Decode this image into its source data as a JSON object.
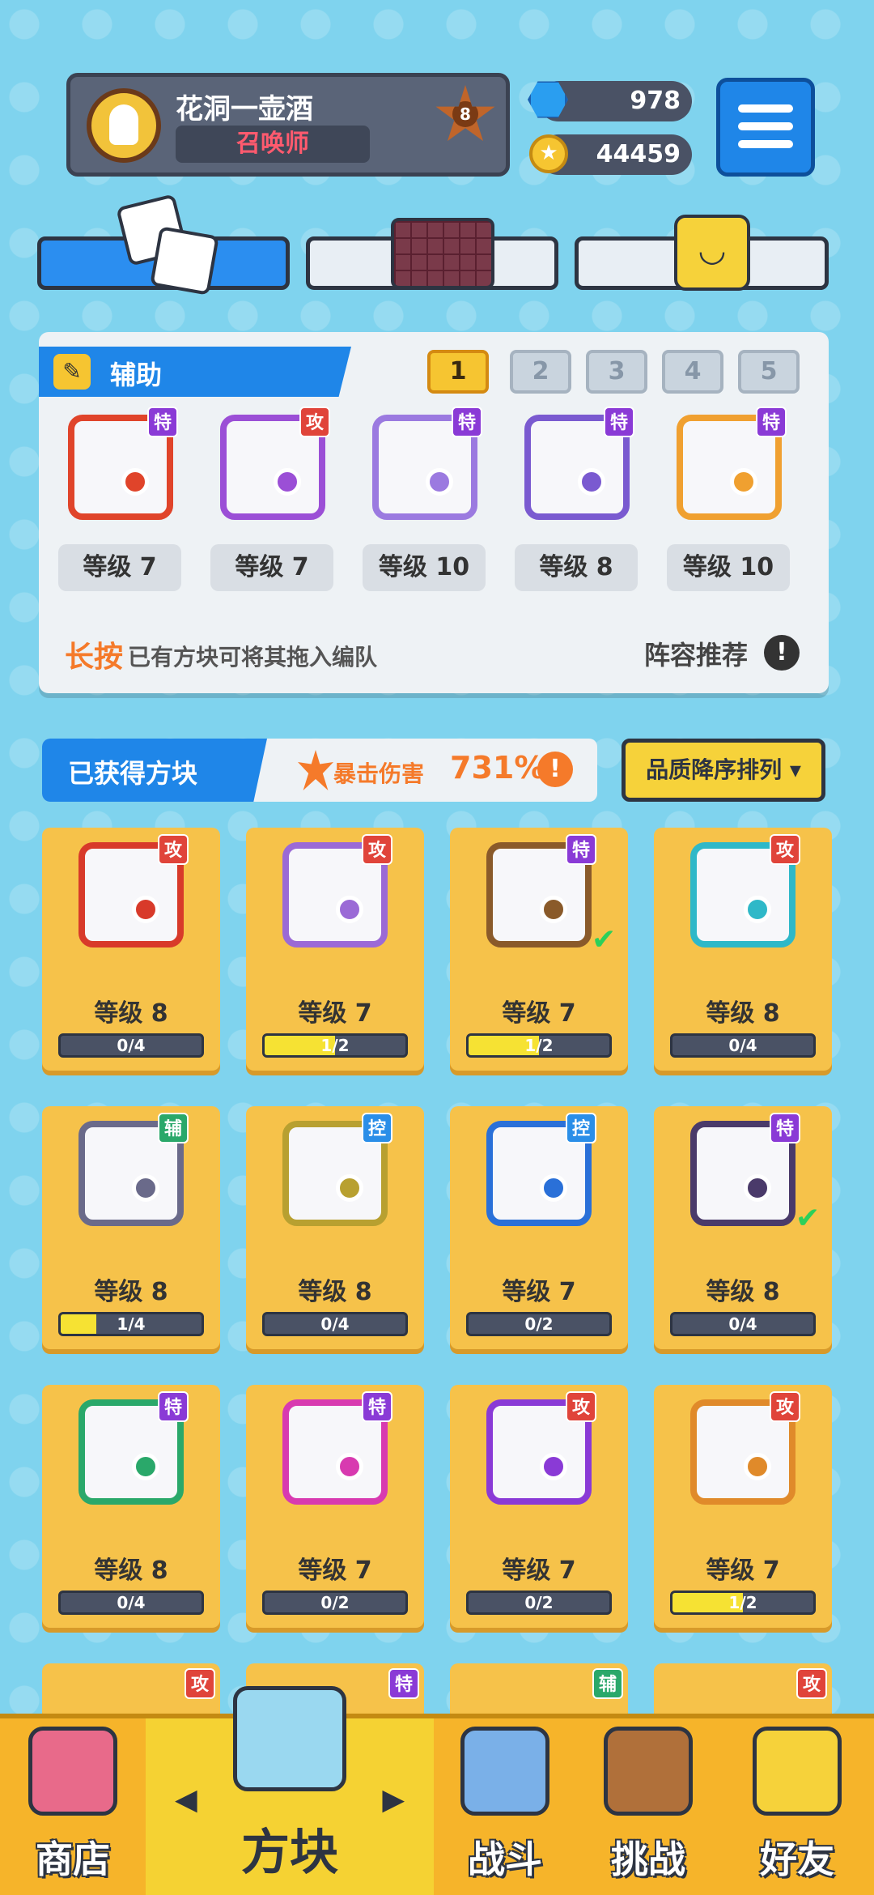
{
  "player": {
    "name": "花洞一壶酒",
    "title": "召唤师",
    "rank": "8"
  },
  "resources": {
    "gems": "978",
    "coins": "44459"
  },
  "category_tabs": [
    {
      "icon": "dice-icon",
      "active": true
    },
    {
      "icon": "board-icon",
      "active": false
    },
    {
      "icon": "emoji-icon",
      "active": false
    }
  ],
  "loadout": {
    "heading": "辅助",
    "slots": [
      "1",
      "2",
      "3",
      "4",
      "5"
    ],
    "active_slot": "1",
    "dice": [
      {
        "badge": "特",
        "badge_color": "#8a3ad6",
        "frame": "#e0442a",
        "level": "等级 7"
      },
      {
        "badge": "攻",
        "badge_color": "#e0443a",
        "frame": "#9b4fd6",
        "level": "等级 7"
      },
      {
        "badge": "特",
        "badge_color": "#8a3ad6",
        "frame": "#9b7ae0",
        "level": "等级 10"
      },
      {
        "badge": "特",
        "badge_color": "#8a3ad6",
        "frame": "#7a5ad0",
        "level": "等级 8"
      },
      {
        "badge": "特",
        "badge_color": "#8a3ad6",
        "frame": "#f0a030",
        "level": "等级 10"
      }
    ],
    "hint_emphasis": "长按",
    "hint_text": "已有方块可将其拖入编队",
    "recommend": "阵容推荐",
    "recommend_icon": "!"
  },
  "owned": {
    "title": "已获得方块",
    "crit_label": "暴击伤害",
    "crit_value": "731%",
    "info_icon": "!",
    "sort_label": "品质降序排列 ▾"
  },
  "cards": [
    {
      "badge": "攻",
      "badge_color": "#e0443a",
      "frame": "#d83a2a",
      "level": "等级 8",
      "progress": "0/4",
      "fill": 0,
      "check": false
    },
    {
      "badge": "攻",
      "badge_color": "#e0443a",
      "frame": "#9b6ad6",
      "level": "等级 7",
      "progress": "1/2",
      "fill": 0.5,
      "check": false
    },
    {
      "badge": "特",
      "badge_color": "#8a3ad6",
      "frame": "#8a5a2a",
      "level": "等级 7",
      "progress": "1/2",
      "fill": 0.5,
      "check": true
    },
    {
      "badge": "攻",
      "badge_color": "#e0443a",
      "frame": "#2fb8c8",
      "level": "等级 8",
      "progress": "0/4",
      "fill": 0,
      "check": false
    },
    {
      "badge": "辅",
      "badge_color": "#2aa86a",
      "frame": "#6a6a8a",
      "level": "等级 8",
      "progress": "1/4",
      "fill": 0.25,
      "check": false
    },
    {
      "badge": "控",
      "badge_color": "#2a8ee8",
      "frame": "#b8a030",
      "level": "等级 8",
      "progress": "0/4",
      "fill": 0,
      "check": false
    },
    {
      "badge": "控",
      "badge_color": "#2a8ee8",
      "frame": "#2a70d8",
      "level": "等级 7",
      "progress": "0/2",
      "fill": 0,
      "check": false
    },
    {
      "badge": "特",
      "badge_color": "#8a3ad6",
      "frame": "#4a3a6a",
      "level": "等级 8",
      "progress": "0/4",
      "fill": 0,
      "check": true
    },
    {
      "badge": "特",
      "badge_color": "#8a3ad6",
      "frame": "#2aa86a",
      "level": "等级 8",
      "progress": "0/4",
      "fill": 0,
      "check": false
    },
    {
      "badge": "特",
      "badge_color": "#8a3ad6",
      "frame": "#d83ab0",
      "level": "等级 7",
      "progress": "0/2",
      "fill": 0,
      "check": false
    },
    {
      "badge": "攻",
      "badge_color": "#e0443a",
      "frame": "#8a3ad6",
      "level": "等级 7",
      "progress": "0/2",
      "fill": 0,
      "check": false
    },
    {
      "badge": "攻",
      "badge_color": "#e0443a",
      "frame": "#e08a2a",
      "level": "等级 7",
      "progress": "1/2",
      "fill": 0.5,
      "check": false
    }
  ],
  "partial_row_badges": [
    {
      "badge": "攻",
      "badge_color": "#e0443a"
    },
    {
      "badge": "特",
      "badge_color": "#8a3ad6"
    },
    {
      "badge": "辅",
      "badge_color": "#2aa86a"
    },
    {
      "badge": "攻",
      "badge_color": "#e0443a"
    }
  ],
  "nav": {
    "items": [
      {
        "label": "商店",
        "icon": "shop-icon",
        "icon_color": "#e86a8a",
        "active": false
      },
      {
        "label": "方块",
        "icon": "dice-box-icon",
        "icon_color": "#9ad8f0",
        "active": true
      },
      {
        "label": "战斗",
        "icon": "sword-shield-icon",
        "icon_color": "#7ab0e8",
        "active": false
      },
      {
        "label": "挑战",
        "icon": "challenge-icon",
        "icon_color": "#b0703a",
        "active": false
      },
      {
        "label": "好友",
        "icon": "friends-icon",
        "icon_color": "#f6d23a",
        "active": false
      }
    ],
    "prev_arrow": "◀",
    "next_arrow": "▶"
  },
  "colors": {
    "accent_blue": "#1f86e8",
    "card_yellow": "#f6c24a",
    "crit_orange": "#f57a2a"
  }
}
